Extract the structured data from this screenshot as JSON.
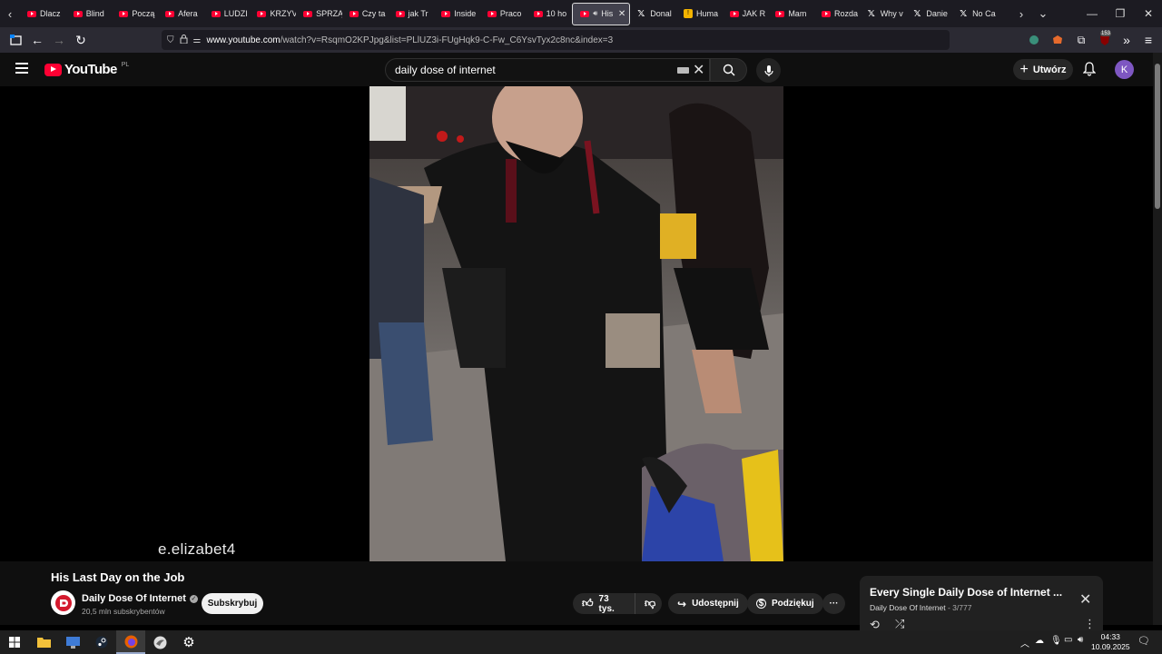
{
  "browser": {
    "tabs": [
      {
        "title": "Dlacz",
        "favicon": "youtube-icon"
      },
      {
        "title": "Blind",
        "favicon": "youtube-icon"
      },
      {
        "title": "Począ",
        "favicon": "youtube-icon"
      },
      {
        "title": "Afera",
        "favicon": "youtube-icon"
      },
      {
        "title": "LUDZI",
        "favicon": "youtube-icon"
      },
      {
        "title": "KRZYV",
        "favicon": "youtube-icon"
      },
      {
        "title": "SPRZĄ",
        "favicon": "youtube-icon"
      },
      {
        "title": "Czy ta",
        "favicon": "youtube-icon"
      },
      {
        "title": "jak Tr",
        "favicon": "youtube-icon"
      },
      {
        "title": "Inside",
        "favicon": "youtube-icon"
      },
      {
        "title": "Praco",
        "favicon": "youtube-icon"
      },
      {
        "title": "10 ho",
        "favicon": "youtube-icon"
      },
      {
        "title": "His",
        "favicon": "youtube-icon",
        "active": true
      },
      {
        "title": "Donal",
        "favicon": "x-icon"
      },
      {
        "title": "Huma",
        "favicon": "h-icon"
      },
      {
        "title": "JAK R",
        "favicon": "youtube-icon"
      },
      {
        "title": "Mam",
        "favicon": "youtube-icon"
      },
      {
        "title": "Rozda",
        "favicon": "youtube-icon"
      },
      {
        "title": "Why v",
        "favicon": "x-icon"
      },
      {
        "title": "Danie",
        "favicon": "x-icon"
      },
      {
        "title": "No Ca",
        "favicon": "x-icon"
      }
    ],
    "url_host": "www.youtube.com",
    "url_rest": "/watch?v=RsqmO2KPJpg&list=PLlUZ3i-FUgHqk9-C-Fw_C6YsvTyx2c8nc&index=3",
    "extension_badge": "153"
  },
  "youtube": {
    "logo_text": "YouTube",
    "region": "PL",
    "search_value": "daily dose of internet",
    "create_label": "Utwórz",
    "avatar_letter": "K"
  },
  "video": {
    "watermark": "e.elizabet4",
    "title": "His Last Day on the Job",
    "channel": "Daily Dose Of Internet",
    "subscribers": "20,5 mln subskrybentów",
    "subscribe_label": "Subskrybuj",
    "likes": "73 tys.",
    "share_label": "Udostępnij",
    "thanks_label": "Podziękuj"
  },
  "playlist": {
    "title": "Every Single Daily Dose of Internet ...",
    "channel": "Daily Dose Of Internet",
    "position": " - 3/777"
  },
  "taskbar": {
    "time": "04:33",
    "date": "10.09.2025"
  },
  "colors": {
    "youtube_red": "#ff0033",
    "avatar": "#7e57c2",
    "bg": "#0f0f0f"
  }
}
